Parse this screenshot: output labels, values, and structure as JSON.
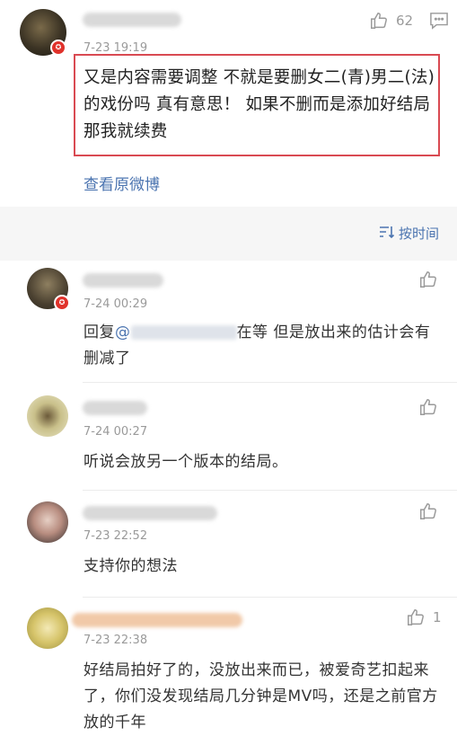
{
  "main_comment": {
    "timestamp": "7-23 19:19",
    "likes": "62",
    "text": "又是内容需要调整 不就是要删女二(青)男二(法)的戏份吗 真有意思！ 如果不删而是添加好结局 那我就续费",
    "view_original": "查看原微博"
  },
  "sort_label": "按时间",
  "replies": [
    {
      "timestamp": "7-24 00:29",
      "prefix": "回复",
      "at": "@",
      "text_after": "在等 但是放出来的估计会有删减了",
      "likes": ""
    },
    {
      "timestamp": "7-24 00:27",
      "text": "听说会放另一个版本的结局。",
      "likes": ""
    },
    {
      "timestamp": "7-23 22:52",
      "text": "支持你的想法",
      "likes": ""
    },
    {
      "timestamp": "7-23 22:38",
      "text": "好结局拍好了的，没放出来而已，被爱奇艺扣起来了，你们没发现结局几分钟是MV吗，还是之前官方放的千年",
      "likes": "1"
    }
  ],
  "icons": {
    "like": "thumbs-up-icon",
    "comment": "comment-icon",
    "sort": "sort-icon",
    "verified": "verified-badge-icon"
  },
  "colors": {
    "link": "#4b74b0",
    "highlight": "#d94a52",
    "badge": "#e0322b"
  }
}
